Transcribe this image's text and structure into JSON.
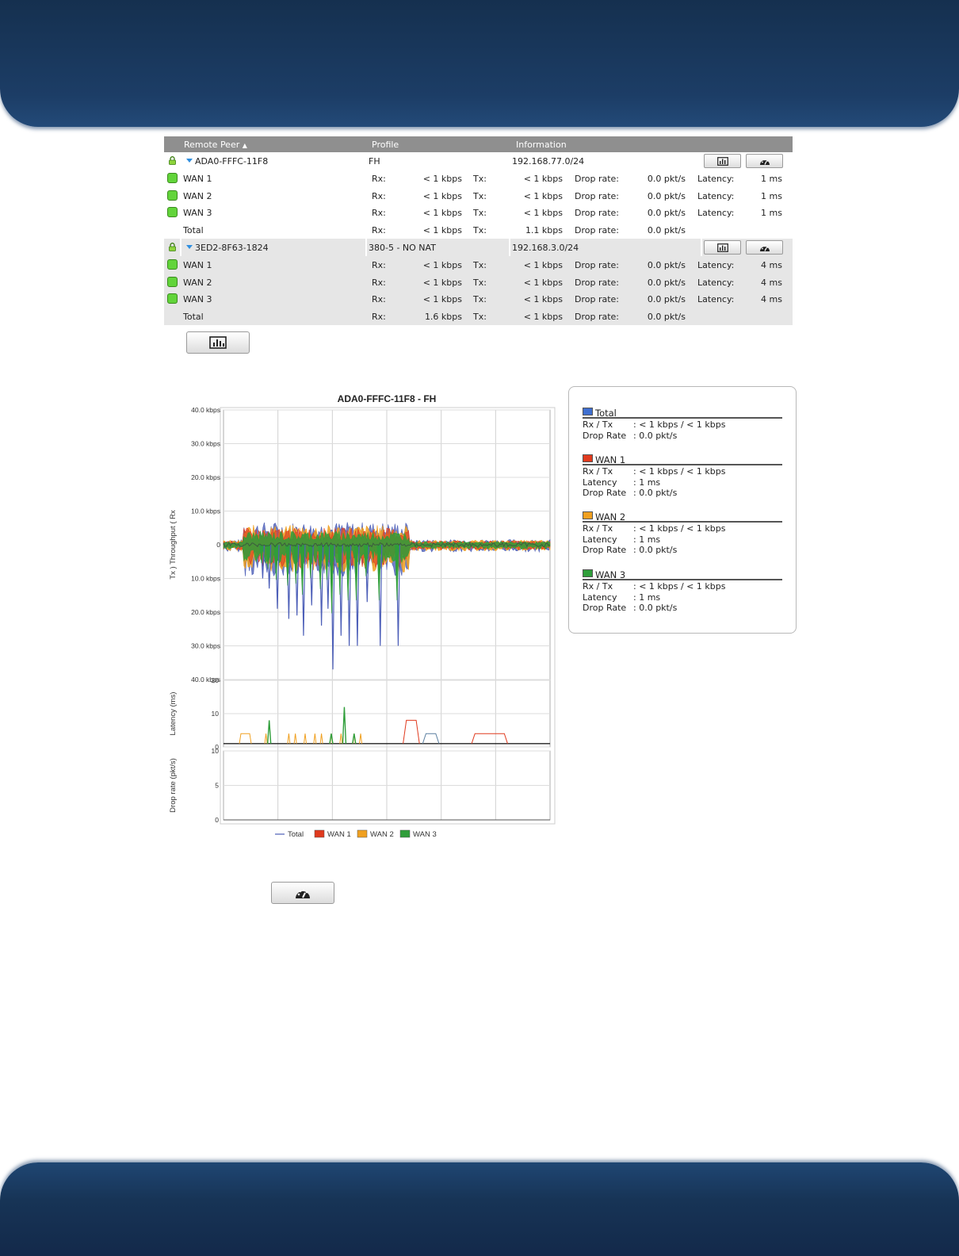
{
  "table": {
    "headers": {
      "remote_peer": "Remote Peer",
      "profile": "Profile",
      "information": "Information"
    },
    "labels": {
      "rx": "Rx:",
      "tx": "Tx:",
      "drop_rate": "Drop rate:",
      "latency": "Latency:"
    },
    "peers": [
      {
        "name": "ADA0-FFFC-11F8",
        "profile": "FH",
        "network": "192.168.77.0/24",
        "rows": [
          {
            "name": "WAN 1",
            "rx": "< 1 kbps",
            "tx": "< 1 kbps",
            "drop": "0.0 pkt/s",
            "latency": "1 ms"
          },
          {
            "name": "WAN 2",
            "rx": "< 1 kbps",
            "tx": "< 1 kbps",
            "drop": "0.0 pkt/s",
            "latency": "1 ms"
          },
          {
            "name": "WAN 3",
            "rx": "< 1 kbps",
            "tx": "< 1 kbps",
            "drop": "0.0 pkt/s",
            "latency": "1 ms"
          }
        ],
        "total": {
          "name": "Total",
          "rx": "< 1 kbps",
          "tx": "1.1 kbps",
          "drop": "0.0 pkt/s"
        }
      },
      {
        "name": "3ED2-8F63-1824",
        "profile": "380-5 - NO NAT",
        "network": "192.168.3.0/24",
        "rows": [
          {
            "name": "WAN 1",
            "rx": "< 1 kbps",
            "tx": "< 1 kbps",
            "drop": "0.0 pkt/s",
            "latency": "4 ms"
          },
          {
            "name": "WAN 2",
            "rx": "< 1 kbps",
            "tx": "< 1 kbps",
            "drop": "0.0 pkt/s",
            "latency": "4 ms"
          },
          {
            "name": "WAN 3",
            "rx": "< 1 kbps",
            "tx": "< 1 kbps",
            "drop": "0.0 pkt/s",
            "latency": "4 ms"
          }
        ],
        "total": {
          "name": "Total",
          "rx": "1.6 kbps",
          "tx": "< 1 kbps",
          "drop": "0.0 pkt/s"
        }
      }
    ]
  },
  "icons": {
    "chart_button": "bar-chart-icon",
    "speed_button": "speedometer-icon",
    "lock": "lock-icon",
    "expand": "expand-triangle-icon"
  },
  "chart_data": {
    "type": "area",
    "title": "ADA0-FFFC-11F8 - FH",
    "panels": [
      {
        "ylabel": "Tx ) Throughput ( Rx",
        "yticks": [
          "40.0 kbps",
          "30.0 kbps",
          "20.0 kbps",
          "10.0 kbps",
          "0",
          "10.0 kbps",
          "20.0 kbps",
          "30.0 kbps",
          "40.0 kbps"
        ],
        "ylim": [
          -40,
          40
        ],
        "unit": "kbps"
      },
      {
        "ylabel": "Latency (ms)",
        "yticks": [
          "20",
          "10",
          "0"
        ],
        "ylim": [
          0,
          20
        ]
      },
      {
        "ylabel": "Drop rate (pkt/s)",
        "yticks": [
          "10",
          "5",
          "0"
        ],
        "ylim": [
          0,
          10
        ]
      }
    ],
    "legend": [
      "Total",
      "WAN 1",
      "WAN 2",
      "WAN 3"
    ],
    "colors": {
      "Total": "#4d5fb8",
      "WAN 1": "#e03a1e",
      "WAN 2": "#f0a020",
      "WAN 3": "#2f9e3a"
    },
    "throughput_dips": [
      {
        "x": 0.12,
        "y": -10
      },
      {
        "x": 0.14,
        "y": -13
      },
      {
        "x": 0.165,
        "y": -19
      },
      {
        "x": 0.2,
        "y": -22
      },
      {
        "x": 0.225,
        "y": -21
      },
      {
        "x": 0.245,
        "y": -27
      },
      {
        "x": 0.27,
        "y": -18
      },
      {
        "x": 0.3,
        "y": -24
      },
      {
        "x": 0.32,
        "y": -19
      },
      {
        "x": 0.335,
        "y": -37
      },
      {
        "x": 0.36,
        "y": -27
      },
      {
        "x": 0.385,
        "y": -30
      },
      {
        "x": 0.41,
        "y": -30
      },
      {
        "x": 0.44,
        "y": -17
      },
      {
        "x": 0.48,
        "y": -30
      },
      {
        "x": 0.535,
        "y": -30
      }
    ],
    "latency_series": {
      "WAN 3 spike": 12,
      "WAN 3 spike 2": 8,
      "WAN 1 step": 8,
      "Total step": 4,
      "WAN 1 step 2": 4,
      "baseline": 1
    },
    "drop_rate": 0
  },
  "info_box": {
    "sections": [
      {
        "title": "Total",
        "color": "#3f6fd0",
        "lines": [
          {
            "k": "Rx / Tx",
            "v": ": < 1 kbps / < 1 kbps"
          },
          {
            "k": "Drop Rate",
            "v": ": 0.0 pkt/s"
          }
        ]
      },
      {
        "title": "WAN 1",
        "color": "#e03a1e",
        "lines": [
          {
            "k": "Rx / Tx",
            "v": ": < 1 kbps / < 1 kbps"
          },
          {
            "k": "Latency",
            "v": ": 1 ms"
          },
          {
            "k": "Drop Rate",
            "v": ": 0.0 pkt/s"
          }
        ]
      },
      {
        "title": "WAN 2",
        "color": "#f0a020",
        "lines": [
          {
            "k": "Rx / Tx",
            "v": ": < 1 kbps / < 1 kbps"
          },
          {
            "k": "Latency",
            "v": ": 1 ms"
          },
          {
            "k": "Drop Rate",
            "v": ": 0.0 pkt/s"
          }
        ]
      },
      {
        "title": "WAN 3",
        "color": "#2f9e3a",
        "lines": [
          {
            "k": "Rx / Tx",
            "v": ": < 1 kbps / < 1 kbps"
          },
          {
            "k": "Latency",
            "v": ": 1 ms"
          },
          {
            "k": "Drop Rate",
            "v": ": 0.0 pkt/s"
          }
        ]
      }
    ]
  }
}
